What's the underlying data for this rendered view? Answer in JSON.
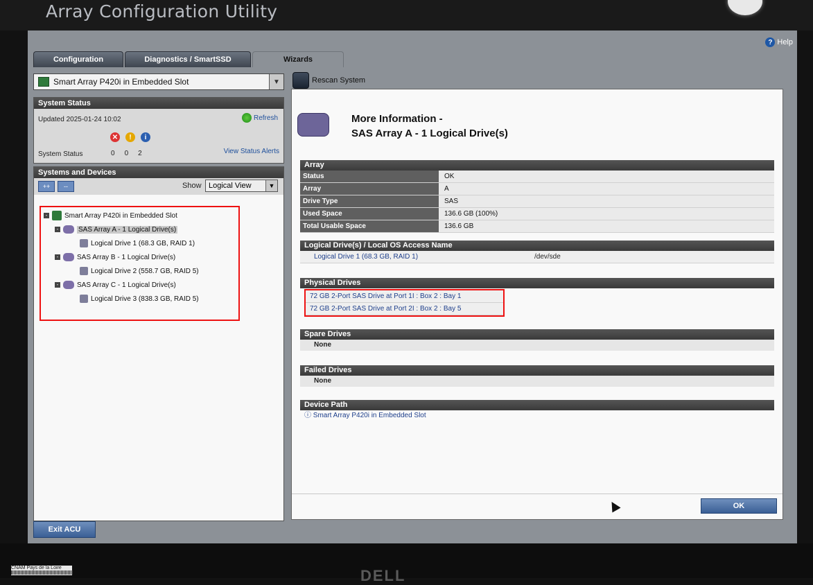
{
  "app": {
    "title": "Array Configuration Utility",
    "help": "Help"
  },
  "tabs": [
    "Configuration",
    "Diagnostics / SmartSSD",
    "Wizards"
  ],
  "selector": {
    "value": "Smart Array P420i in Embedded Slot"
  },
  "toolbar": {
    "rescan": "Rescan System"
  },
  "system_status": {
    "header": "System Status",
    "updated": "Updated 2025-01-24 10:02",
    "refresh": "Refresh",
    "label": "System Status",
    "counts": [
      "0",
      "0",
      "2"
    ],
    "view_alerts": "View Status Alerts"
  },
  "systems_devices": {
    "header": "Systems and Devices",
    "expand": "++",
    "collapse": "--",
    "show_label": "Show",
    "view": "Logical View",
    "tree": [
      "Smart Array P420i in Embedded Slot",
      "SAS Array A - 1 Logical Drive(s)",
      "Logical Drive 1 (68.3 GB, RAID 1)",
      "SAS Array B - 1 Logical Drive(s)",
      "Logical Drive 2 (558.7 GB, RAID 5)",
      "SAS Array C - 1 Logical Drive(s)",
      "Logical Drive 3 (838.3 GB, RAID 5)"
    ]
  },
  "info": {
    "title_line1": "More Information -",
    "title_line2": "SAS Array A - 1 Logical Drive(s)",
    "array_header": "Array",
    "array_rows": [
      {
        "k": "Status",
        "v": "OK"
      },
      {
        "k": "Array",
        "v": "A"
      },
      {
        "k": "Drive Type",
        "v": "SAS"
      },
      {
        "k": "Used Space",
        "v": "136.6 GB (100%)"
      },
      {
        "k": "Total Usable Space",
        "v": "136.6 GB"
      }
    ],
    "ld_header": "Logical Drive(s) / Local OS Access Name",
    "ld_row": {
      "name": "Logical Drive 1 (68.3 GB, RAID 1)",
      "access": "/dev/sde"
    },
    "physical_header": "Physical Drives",
    "physical": [
      "72 GB 2-Port SAS Drive at Port 1I : Box 2 : Bay 1",
      "72 GB 2-Port SAS Drive at Port 2I : Box 2 : Bay 5"
    ],
    "spare_header": "Spare Drives",
    "spare_value": "None",
    "failed_header": "Failed Drives",
    "failed_value": "None",
    "device_path_header": "Device Path",
    "device_path": "Smart Array P420i in Embedded Slot",
    "ok": "OK"
  },
  "exit": "Exit ACU",
  "sticker": "CNAM Pays de la Loire",
  "brand": "DELL"
}
